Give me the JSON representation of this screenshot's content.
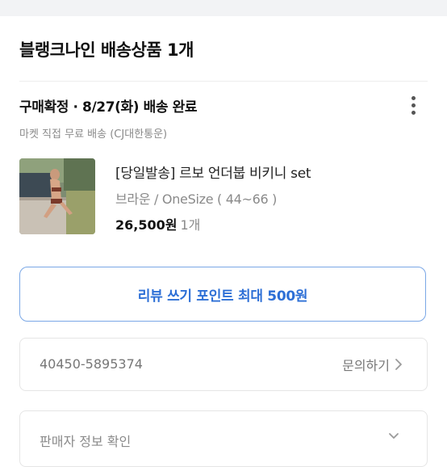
{
  "seller": {
    "title": "블랭크나인 배송상품 1개"
  },
  "order": {
    "status": "구매확정 · 8/27(화) 배송 완료",
    "delivery_info": "마켓 직접 무료 배송 (CJ대한통운)"
  },
  "product": {
    "name": "[당일발송] 르보 언더붑 비키니 set",
    "option": "브라운 / OneSize ( 44~66 )",
    "price": "26,500원",
    "quantity": "1개"
  },
  "review_button": {
    "label": "리뷰 쓰기 포인트 최대 500원"
  },
  "tracking": {
    "number": "40450-5895374",
    "inquiry_label": "문의하기"
  },
  "seller_info": {
    "label": "판매자 정보 확인"
  },
  "colors": {
    "accent": "#2d6fd6",
    "accent_border": "#7aa7e6",
    "muted": "#8a8a8a"
  },
  "icons": {
    "more": "more-vertical-icon",
    "chevron_right": "chevron-right-icon",
    "chevron_down": "chevron-down-icon"
  }
}
